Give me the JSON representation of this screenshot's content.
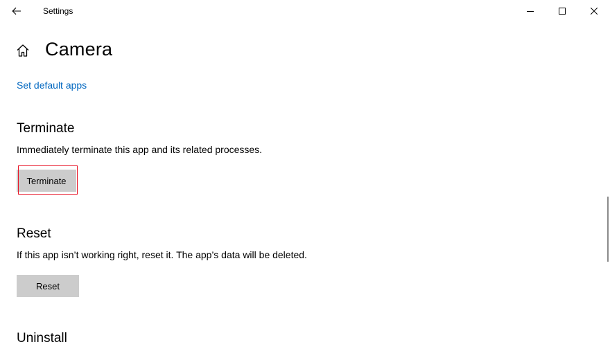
{
  "window": {
    "title": "Settings"
  },
  "header": {
    "title": "Camera"
  },
  "links": {
    "set_default_apps": "Set default apps"
  },
  "terminate": {
    "heading": "Terminate",
    "description": "Immediately terminate this app and its related processes.",
    "button_label": "Terminate"
  },
  "reset": {
    "heading": "Reset",
    "description": "If this app isn’t working right, reset it. The app’s data will be deleted.",
    "button_label": "Reset"
  },
  "uninstall": {
    "heading": "Uninstall"
  },
  "colors": {
    "accent_link": "#0067c0",
    "button_bg": "#cccccc",
    "highlight": "#e81123"
  },
  "icons": {
    "back": "back-arrow-icon",
    "home": "home-icon",
    "minimize": "minimize-icon",
    "maximize": "maximize-icon",
    "close": "close-icon"
  }
}
